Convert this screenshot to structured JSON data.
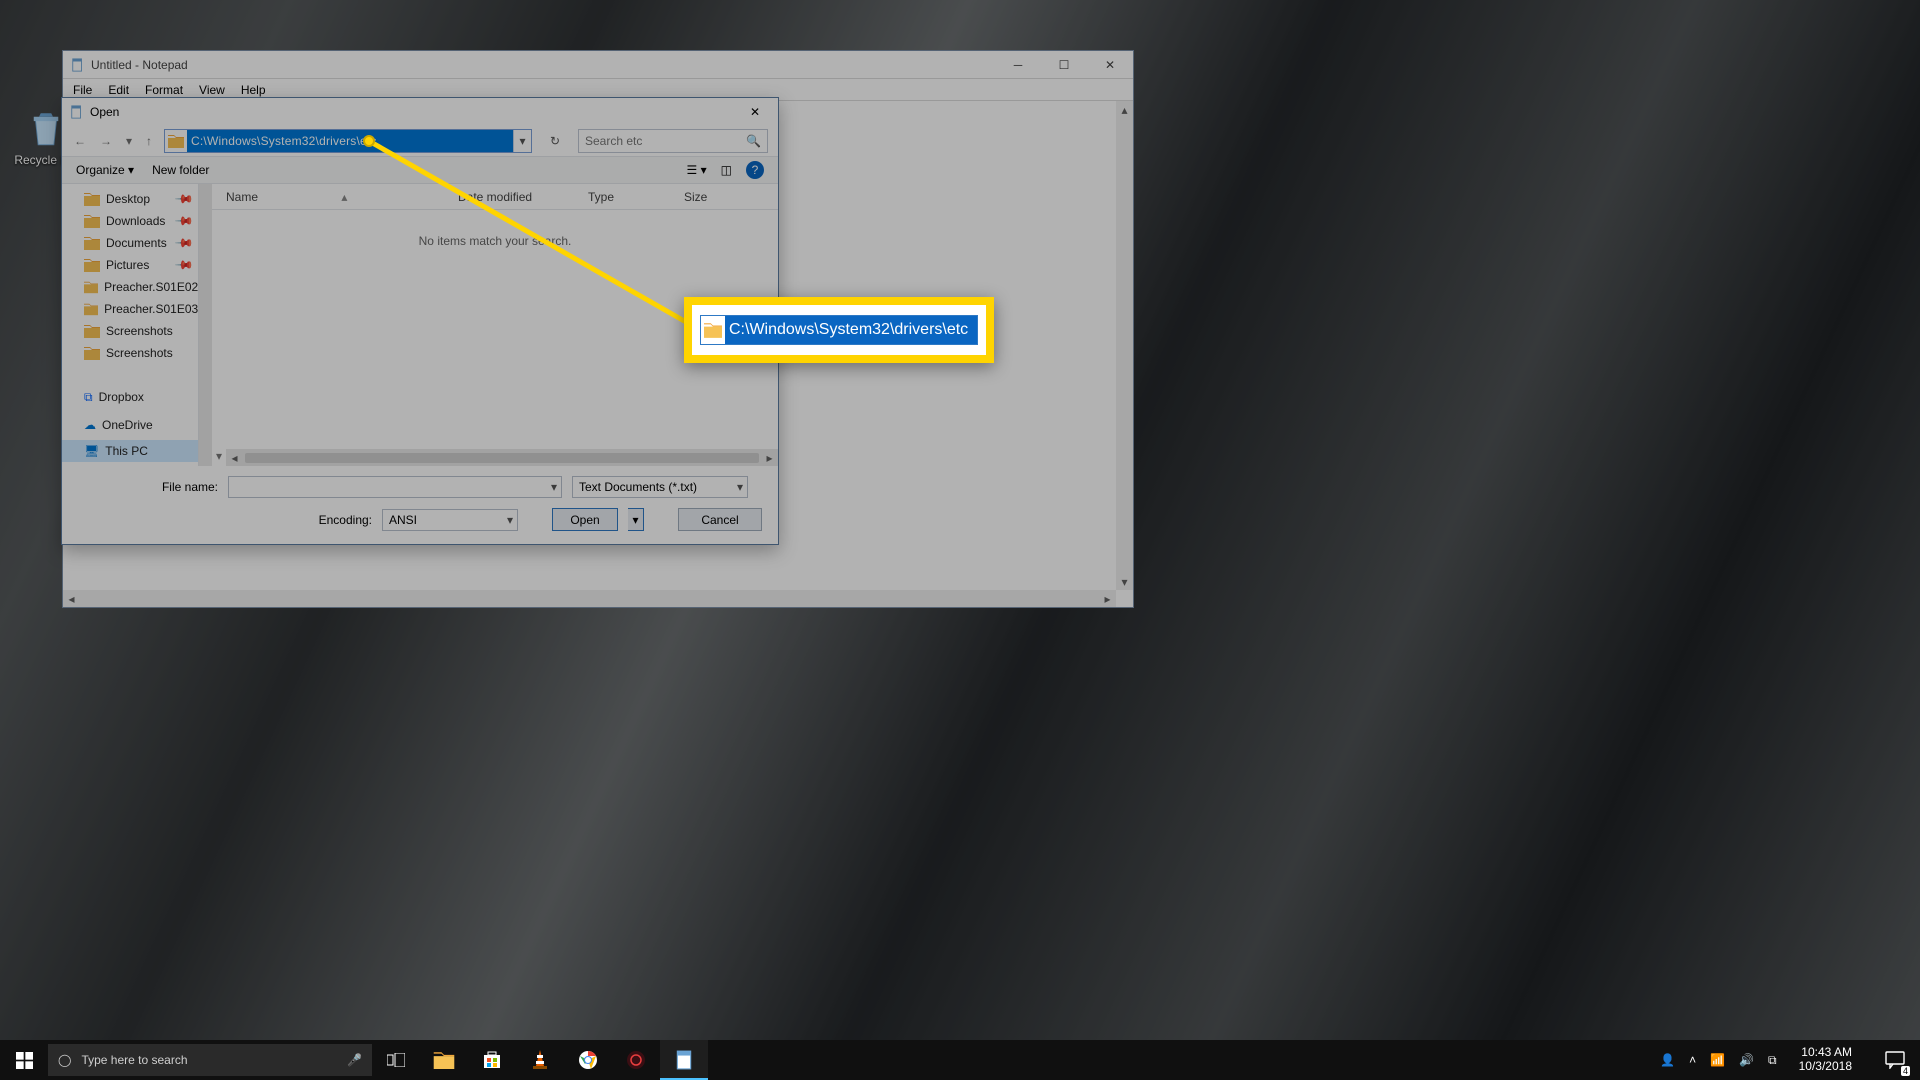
{
  "desktop": {
    "recycle_bin_label": "Recycle Bin"
  },
  "notepad": {
    "title": "Untitled - Notepad",
    "menu": {
      "file": "File",
      "edit": "Edit",
      "format": "Format",
      "view": "View",
      "help": "Help"
    }
  },
  "open_dialog": {
    "title": "Open",
    "address_path": "C:\\Windows\\System32\\drivers\\etc",
    "search_placeholder": "Search etc",
    "toolbar": {
      "organize": "Organize",
      "new_folder": "New folder"
    },
    "columns": {
      "name": "Name",
      "date": "Date modified",
      "type": "Type",
      "size": "Size"
    },
    "empty_message": "No items match your search.",
    "tree": [
      {
        "label": "Desktop",
        "pinned": true
      },
      {
        "label": "Downloads",
        "pinned": true
      },
      {
        "label": "Documents",
        "pinned": true
      },
      {
        "label": "Pictures",
        "pinned": true
      },
      {
        "label": "Preacher.S01E02"
      },
      {
        "label": "Preacher.S01E03"
      },
      {
        "label": "Screenshots"
      },
      {
        "label": "Screenshots"
      },
      {
        "label": "Dropbox",
        "special": "dropbox"
      },
      {
        "label": "OneDrive",
        "special": "onedrive"
      },
      {
        "label": "This PC",
        "special": "thispc",
        "selected": true
      }
    ],
    "file_name_label": "File name:",
    "file_name_value": "",
    "file_type_value": "Text Documents (*.txt)",
    "encoding_label": "Encoding:",
    "encoding_value": "ANSI",
    "open_label": "Open",
    "cancel_label": "Cancel"
  },
  "callout": {
    "path": "C:\\Windows\\System32\\drivers\\etc"
  },
  "taskbar": {
    "search_placeholder": "Type here to search",
    "clock_time": "10:43 AM",
    "clock_date": "10/3/2018",
    "notification_badge": "4"
  }
}
